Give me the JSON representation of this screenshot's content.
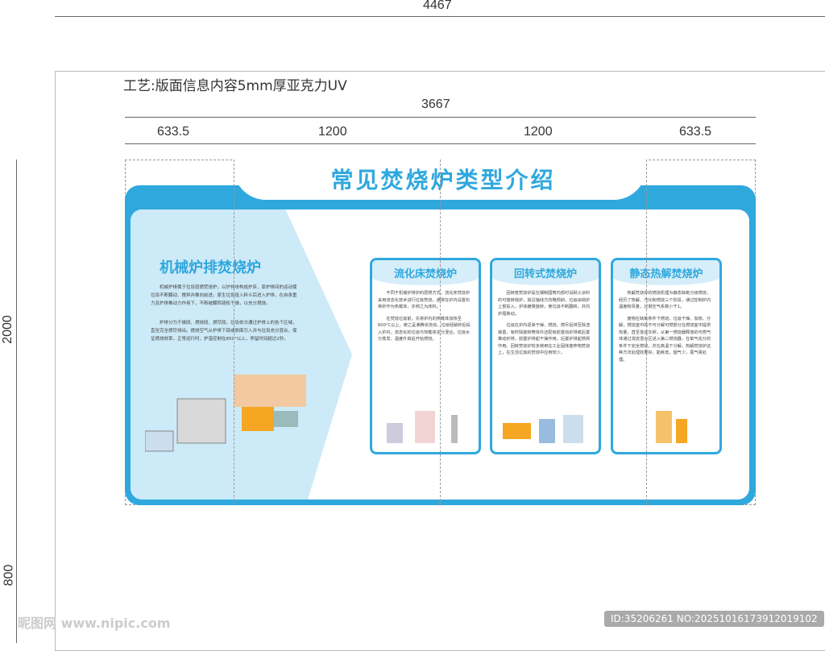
{
  "dimensions": {
    "total_width": "4467",
    "board_width": "3667",
    "segments": [
      "633.5",
      "1200",
      "1200",
      "633.5"
    ],
    "total_height": "2000",
    "base_height": "800"
  },
  "note": "工艺:版面信息内容5mm厚亚克力UV",
  "board": {
    "title": "常见焚烧炉类型介绍",
    "main": {
      "heading": "机械炉排焚烧炉",
      "paragraphs": [
        "机械炉排属于垃圾层燃焚烧炉，以炉排块构成炉床，靠炉排间的运动使垃圾不断翻动、搅拌并推向前进。原生垃圾投入料斗后进入炉排，在自身重力及炉排推动力作用下，不断被翻转疏松干燥，以充分燃烧。",
        "炉排分为干燥段、燃烧段、燃尽段，垃圾依次通过炉排上的各个区域，直至完全燃尽排出。燃烧空气从炉排下部或侧面引入并与垃圾充分混合，保证燃烧效率。正常运行时，炉温控制在850°以上，停留时间超过2秒。"
      ]
    },
    "cards": [
      {
        "heading": "流化床焚烧炉",
        "paragraphs": [
          "不同于机械炉排炉的层燃方式，流化床焚烧炉采用流态化技术进行垃圾焚烧，通常在炉内设置石英砂作为热载体，亦称之为床料。",
          "在焚烧垃圾前，先将炉内的热载体加热至600°C以上，使之呈沸腾状流动，垃圾经破碎后投入炉内，流态化的垃圾与热载体充分混合，垃圾水分蒸发，温度升高后开始燃烧。"
        ]
      },
      {
        "heading": "回转式焚烧炉",
        "paragraphs": [
          "回转窑焚烧炉是在钢制圆筒内部衬设耐火涂料的可旋转锅炉，其沿轴线方向略倾斜，垃圾由锅炉上部投入，炉体缓慢旋转，使垃圾不断翻转，并向炉尾移动。",
          "垃圾在炉内逐渐干燥、燃烧，燃尽后排至除渣装置，有时除旋转筒体外还配有前置动炉排或后置推动炉排，前置炉排起干燥作用，后置炉排起燃烬作用。回转焚烧炉较多使用在工业固体废弃物焚烧上，在生活垃圾的焚烧中应用较少。"
        ]
      },
      {
        "heading": "静态热解焚烧炉",
        "paragraphs": [
          "热解焚烧炉的燃烧机理为静态缺氧分级燃烧，经历了热解、汽化和燃烧三个阶段，通过控制炉内温度和风量，过剩空气系数小于1。",
          "废物在缺氧条件下燃烧，垃圾干燥、加热、分解，燃烧室中的不可分解可燃部分在燃烧室中提供热量，直至变成灰烬，从第一燃烧器释放的可燃气体通过湍流混合区进入第二燃烧器，在氧气充分的条件下完全燃烧，并在高温下分解，热解焚烧炉这种方法处理效果好，能耗低，烟气少，尾气易处理。"
        ]
      }
    ]
  },
  "watermark": {
    "left": "昵图网 www.nipic.com",
    "id": "ID:35206261 NO:20251016173912019102"
  },
  "colors": {
    "accent": "#2fa8de",
    "panel": "#cdeaf8"
  }
}
